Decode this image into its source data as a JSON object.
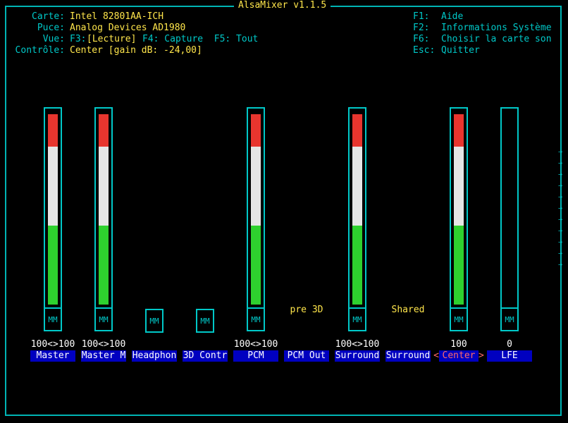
{
  "app": {
    "title": "AlsaMixer v1.1.5"
  },
  "header": {
    "card_label": "Carte:",
    "card_value": "Intel 82801AA-ICH",
    "chip_label": "Puce:",
    "chip_value": "Analog Devices AD1980",
    "view_label": "Vue:",
    "view_f3": "F3:",
    "view_lecture": "[Lecture]",
    "view_rest": "F4: Capture  F5: Tout",
    "control_label": "Contrôle:",
    "control_value": "Center [gain dB: -24,00]"
  },
  "help": [
    {
      "key": "F1:",
      "text": "Aide"
    },
    {
      "key": "F2:",
      "text": "Informations Système"
    },
    {
      "key": "F6:",
      "text": "Choisir la carte son"
    },
    {
      "key": "Esc:",
      "text": "Quitter"
    }
  ],
  "channels": [
    {
      "name": "Master",
      "volume": "100<>100",
      "level": 1.0,
      "has_bar": true,
      "mute": "MM",
      "selected": false
    },
    {
      "name": "Master M",
      "volume": "100<>100",
      "level": 1.0,
      "has_bar": true,
      "mute": "MM",
      "selected": false
    },
    {
      "name": "Headphon",
      "volume": "",
      "level": 0,
      "has_bar": false,
      "mute": "MM",
      "selected": false
    },
    {
      "name": "3D Contr",
      "volume": "",
      "level": 0,
      "has_bar": false,
      "mute": "MM",
      "selected": false
    },
    {
      "name": "PCM",
      "volume": "100<>100",
      "level": 1.0,
      "has_bar": true,
      "mute": "MM",
      "selected": false
    },
    {
      "name": "PCM Out",
      "volume": "",
      "level": 0,
      "has_bar": false,
      "mute": "",
      "selected": false,
      "enum_value": "pre 3D"
    },
    {
      "name": "Surround",
      "volume": "100<>100",
      "level": 1.0,
      "has_bar": true,
      "mute": "MM",
      "selected": false
    },
    {
      "name": "Surround",
      "volume": "",
      "level": 0,
      "has_bar": false,
      "mute": "",
      "selected": false,
      "enum_value": "Shared"
    },
    {
      "name": "Center",
      "volume": "100",
      "level": 1.0,
      "has_bar": true,
      "mute": "MM",
      "selected": true
    },
    {
      "name": "LFE",
      "volume": "0",
      "level": 0,
      "has_bar": true,
      "mute": "MM",
      "selected": false
    }
  ],
  "scroll_indicator": "→",
  "colors": {
    "red": "#e8352e",
    "white": "#e6e6e6",
    "green": "#2ed12e",
    "frame": "#00c8c8",
    "label_bg": "#0000c0",
    "header_value": "#ffe64b"
  }
}
